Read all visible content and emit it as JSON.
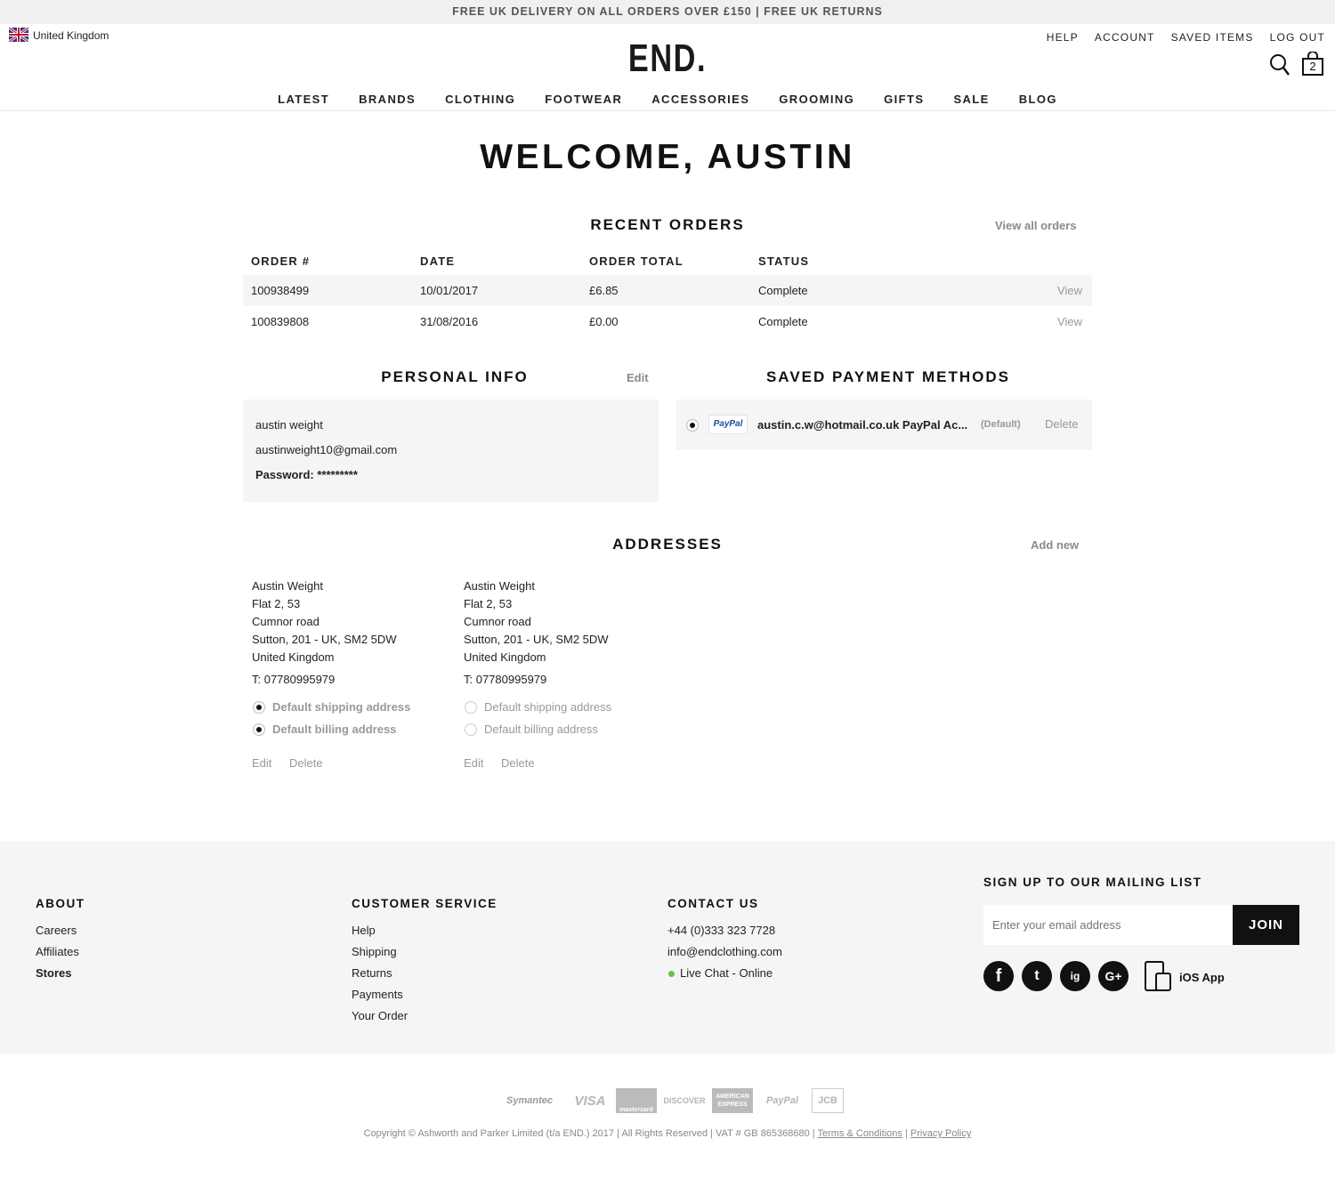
{
  "promo": "FREE UK DELIVERY ON ALL ORDERS OVER £150 | FREE UK RETURNS",
  "header": {
    "country": "United Kingdom",
    "logo": "END.",
    "top_links": [
      "HELP",
      "ACCOUNT",
      "SAVED ITEMS",
      "LOG OUT"
    ],
    "bag_count": "2",
    "nav": [
      "LATEST",
      "BRANDS",
      "CLOTHING",
      "FOOTWEAR",
      "ACCESSORIES",
      "GROOMING",
      "GIFTS",
      "SALE",
      "BLOG"
    ]
  },
  "welcome": "WELCOME, AUSTIN",
  "orders": {
    "title": "RECENT ORDERS",
    "view_all": "View all orders",
    "headers": [
      "ORDER #",
      "DATE",
      "ORDER TOTAL",
      "STATUS"
    ],
    "rows": [
      {
        "number": "100938499",
        "date": "10/01/2017",
        "total": "£6.85",
        "status": "Complete",
        "action": "View"
      },
      {
        "number": "100839808",
        "date": "31/08/2016",
        "total": "£0.00",
        "status": "Complete",
        "action": "View"
      }
    ]
  },
  "personal": {
    "title": "PERSONAL INFO",
    "edit": "Edit",
    "name": "austin weight",
    "email": "austinweight10@gmail.com",
    "password_label": "Password:",
    "password_value": "*********"
  },
  "payment": {
    "title": "SAVED PAYMENT METHODS",
    "brand": "PayPal",
    "account": "austin.c.w@hotmail.co.uk PayPal Ac...",
    "default": "(Default)",
    "delete": "Delete"
  },
  "addresses": {
    "title": "ADDRESSES",
    "add_new": "Add new",
    "items": [
      {
        "name": "Austin Weight",
        "line1": "Flat 2, 53",
        "line2": "Cumnor road",
        "line3": "Sutton, 201 - UK, SM2 5DW",
        "country": "United Kingdom",
        "phone": "T: 07780995979",
        "shipping": "Default shipping address",
        "billing": "Default billing address",
        "edit": "Edit",
        "delete": "Delete"
      },
      {
        "name": "Austin Weight",
        "line1": "Flat 2, 53",
        "line2": "Cumnor road",
        "line3": "Sutton, 201 - UK, SM2 5DW",
        "country": "United Kingdom",
        "phone": "T: 07780995979",
        "shipping": "Default shipping address",
        "billing": "Default billing address",
        "edit": "Edit",
        "delete": "Delete"
      }
    ]
  },
  "footer": {
    "about": {
      "title": "ABOUT",
      "links": [
        "Careers",
        "Affiliates",
        "Stores"
      ]
    },
    "service": {
      "title": "CUSTOMER SERVICE",
      "links": [
        "Help",
        "Shipping",
        "Returns",
        "Payments",
        "Your Order"
      ]
    },
    "contact": {
      "title": "CONTACT US",
      "phone": "+44 (0)333 323 7728",
      "email": "info@endclothing.com",
      "chat": "Live Chat - Online"
    },
    "mailing": {
      "title": "SIGN UP TO OUR MAILING LIST",
      "placeholder": "Enter your email address",
      "join": "JOIN",
      "ios": "iOS App"
    },
    "social": [
      "f",
      "t",
      "ig",
      "G+"
    ]
  },
  "payment_logos": [
    "Symantec",
    "VISA",
    "mastercard",
    "DISCOVER",
    "AMERICAN EXPRESS",
    "PayPal",
    "JCB"
  ],
  "copyright": {
    "text": "Copyright © Ashworth and Parker Limited (t/a END.) 2017 | All Rights Reserved | VAT # GB 865368680 |",
    "terms": "Terms & Conditions",
    "sep": "|",
    "privacy": "Privacy Policy"
  },
  "colors": {
    "accent": "#111111",
    "muted": "#999999",
    "panel": "#f5f5f5",
    "online": "#6cc04a"
  }
}
